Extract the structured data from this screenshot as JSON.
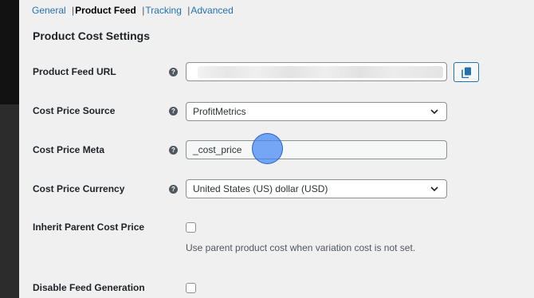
{
  "tabs": [
    {
      "label": "General",
      "current": false
    },
    {
      "label": "Product Feed",
      "current": true
    },
    {
      "label": "Tracking",
      "current": false
    },
    {
      "label": "Advanced",
      "current": false
    }
  ],
  "tab_separator": "|",
  "section_title": "Product Cost Settings",
  "help_glyph": "?",
  "fields": {
    "product_feed_url": {
      "label": "Product Feed URL",
      "value": ""
    },
    "cost_price_source": {
      "label": "Cost Price Source",
      "value": "ProfitMetrics"
    },
    "cost_price_meta": {
      "label": "Cost Price Meta",
      "value": "_cost_price"
    },
    "cost_price_currency": {
      "label": "Cost Price Currency",
      "value": "United States (US) dollar (USD)"
    },
    "inherit_parent_cost_price": {
      "label": "Inherit Parent Cost Price",
      "checked": false,
      "description": "Use parent product cost when variation cost is not set."
    },
    "disable_feed_generation": {
      "label": "Disable Feed Generation",
      "checked": false
    }
  },
  "colors": {
    "accent": "#2271b1",
    "background": "#f0f0f1",
    "cursor_highlight": "#4285f4"
  }
}
